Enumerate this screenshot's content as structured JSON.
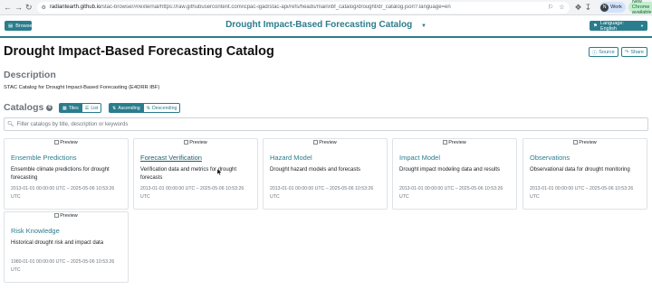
{
  "browser": {
    "url_host": "radiantearth.github.io",
    "url_rest": "/stac-browser/#/external/https://raw.githubusercontent.com/icpac-igad/stac-api/refs/heads/main/ibf_catalog/drought/dr_catalog.json?.language=en",
    "profile_label": "Work",
    "profile_initial": "N",
    "update_label": "New Chrome available"
  },
  "navbar": {
    "browse_label": "Browse",
    "title": "Drought Impact-Based Forecasting Catalog",
    "language_label": "Language: English"
  },
  "header": {
    "page_title": "Drought Impact-Based Forecasting Catalog",
    "source_label": "Source",
    "share_label": "Share"
  },
  "description": {
    "heading": "Description",
    "text": "STAC Catalog for Drought Impact-Based Forecasting (E4DRR IBF)"
  },
  "catalogs": {
    "heading": "Catalogs",
    "count": "6",
    "view_tiles": "Tiles",
    "view_list": "List",
    "sort_asc": "Ascending",
    "sort_desc": "Descending",
    "filter_placeholder": "Filter catalogs by title, description or keywords",
    "preview_alt": "Preview",
    "items": [
      {
        "title": "Ensemble Predictions",
        "description": "Ensemble climate predictions for drought forecasting",
        "dates": "2013-01-01 00:00:00 UTC – 2025-05-06 10:53:26 UTC"
      },
      {
        "title": "Forecast Verification",
        "description": "Verification data and metrics for drought forecasts",
        "dates": "2013-01-01 00:00:00 UTC – 2025-05-06 10:53:26 UTC"
      },
      {
        "title": "Hazard Model",
        "description": "Drought hazard models and forecasts",
        "dates": "2013-01-01 00:00:00 UTC – 2025-05-06 10:53:26 UTC"
      },
      {
        "title": "Impact Model",
        "description": "Drought impact modeling data and results",
        "dates": "2013-01-01 00:00:00 UTC – 2025-05-06 10:53:26 UTC"
      },
      {
        "title": "Observations",
        "description": "Observational data for drought monitoring",
        "dates": "2013-01-01 00:00:00 UTC – 2025-05-06 10:53:26 UTC"
      },
      {
        "title": "Risk Knowledge",
        "description": "Historical drought risk and impact data",
        "dates": "1980-01-01 00:00:00 UTC – 2025-05-06 10:53:26 UTC"
      }
    ]
  },
  "colors": {
    "accent": "#2a7d8d",
    "muted": "#6c757d"
  }
}
